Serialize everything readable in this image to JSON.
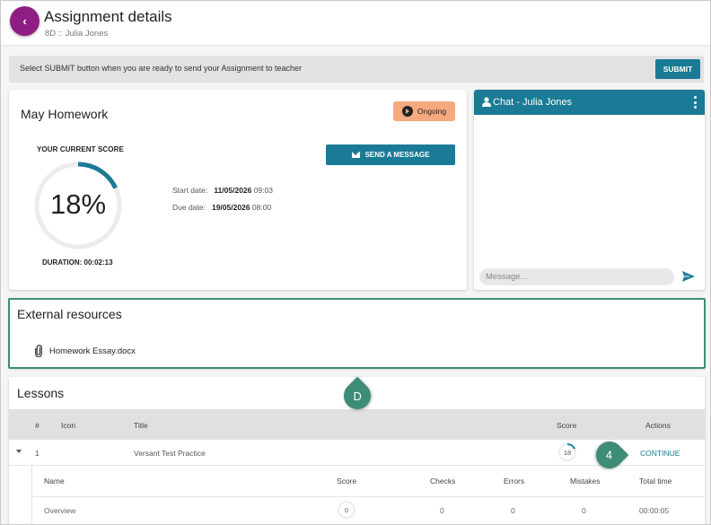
{
  "header": {
    "title": "Assignment details",
    "subtitle": "8D :: Julia Jones",
    "back_icon": "chevron-left-icon"
  },
  "notice": {
    "text": "Select SUBMIT button when you are ready to send your Assignment to teacher",
    "submit_label": "SUBMIT"
  },
  "homework": {
    "title": "May Homework",
    "status": "Ongoing",
    "score_label": "YOUR CURRENT SCORE",
    "score_value": "18%",
    "score_fraction": 0.18,
    "duration": "DURATION: 00:02:13",
    "send_message_label": "SEND A MESSAGE",
    "start_label": "Start date:",
    "start_date": "11/05/2026",
    "start_time": "09:03",
    "due_label": "Due date:",
    "due_date": "19/05/2026",
    "due_time": "08:00"
  },
  "chat": {
    "title": "Chat - Julia Jones",
    "message_placeholder": "Message..."
  },
  "external": {
    "title": "External resources",
    "file": "Homework Essay.docx"
  },
  "lessons": {
    "title": "Lessons",
    "columns": [
      "#",
      "Icon",
      "Title",
      "Score",
      "Actions"
    ],
    "row": {
      "number": "1",
      "title": "Versant Test Practice",
      "score": "18",
      "score_fraction": 0.18,
      "action": "CONTINUE"
    },
    "sub_columns": [
      "Name",
      "Score",
      "Checks",
      "Errors",
      "Mistakes",
      "Total time"
    ],
    "sub_row": {
      "name": "Overview",
      "score": "0",
      "checks": "0",
      "errors": "0",
      "mistakes": "0",
      "total_time": "00:00:05"
    }
  },
  "annotations": {
    "marker_d": "D",
    "marker_4": "4"
  },
  "colors": {
    "accent": "#1b7a95",
    "back_button": "#8e1e83",
    "status_pill": "#f4a97f",
    "annotation": "#3d8c78"
  }
}
